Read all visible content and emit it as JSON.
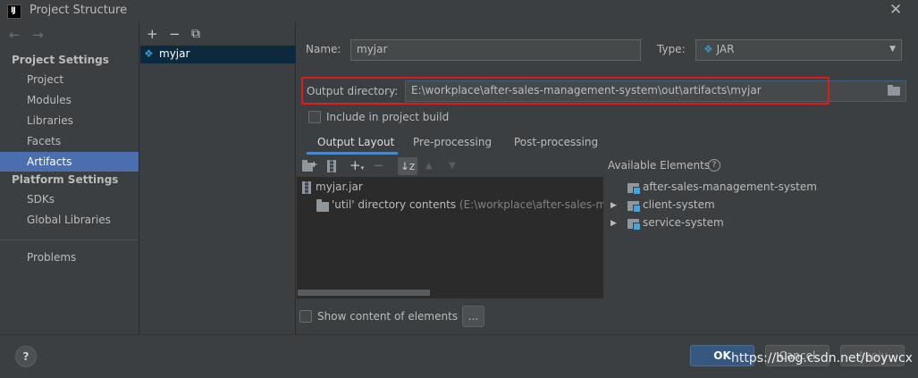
{
  "window": {
    "title": "Project Structure",
    "close_glyph": "✕"
  },
  "nav": {
    "back_glyph": "←",
    "forward_glyph": "→",
    "project_settings_header": "Project Settings",
    "platform_settings_header": "Platform Settings",
    "items": [
      "Project",
      "Modules",
      "Libraries",
      "Facets",
      "Artifacts",
      "SDKs",
      "Global Libraries",
      "Problems"
    ],
    "selected": "Artifacts"
  },
  "artifacts_toolbar": {
    "add_glyph": "+",
    "remove_glyph": "−",
    "copy_glyph": "⧉"
  },
  "artifacts": [
    {
      "name": "myjar",
      "icon": "jar-artifact-icon"
    }
  ],
  "name_field": {
    "label": "Name:",
    "value": "myjar"
  },
  "type_field": {
    "label": "Type:",
    "value": "JAR",
    "icon": "diamond-icon",
    "arrow": "▼"
  },
  "output_dir": {
    "label": "Output directory:",
    "value": "E:\\workplace\\after-sales-management-system\\out\\artifacts\\myjar",
    "browse_icon": "folder-open-icon"
  },
  "include_in_build": {
    "label": "Include in project build",
    "checked": false
  },
  "tabs": [
    "Output Layout",
    "Pre-processing",
    "Post-processing"
  ],
  "active_tab": "Output Layout",
  "output_layout": {
    "root": "myjar.jar",
    "child": "'util' directory contents",
    "child_path": "(E:\\workplace\\after-sales-manag"
  },
  "available_elements": {
    "title": "Available Elements",
    "help_glyph": "?",
    "items": [
      "after-sales-management-system",
      "client-system",
      "service-system"
    ]
  },
  "show_content": {
    "label": "Show content of elements",
    "checked": false,
    "more_button": "..."
  },
  "buttons": {
    "ok": "OK",
    "cancel": "Cancel",
    "apply": "Apply",
    "help": "?"
  },
  "watermark": "https://blog.csdn.net/boywcx",
  "colors": {
    "selection": "#4b6eaf",
    "accent": "#4a88c7",
    "highlight_box": "#e01b1b"
  }
}
